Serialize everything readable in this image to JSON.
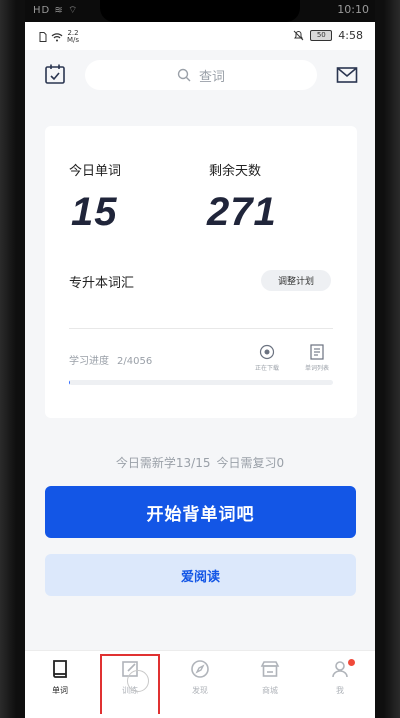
{
  "outer_status": {
    "left": "HD ≋ ⌔",
    "time": "10:10"
  },
  "status_bar": {
    "speed_top": "2.2",
    "speed_bottom": "M/s",
    "battery": "50",
    "time": "4:58"
  },
  "header": {
    "search_placeholder": "查词"
  },
  "stats": {
    "today_label": "今日单词",
    "today_value": "15",
    "remaining_label": "剩余天数",
    "remaining_value": "271",
    "book_name": "专升本词汇",
    "adjust_plan": "调整计划",
    "progress_label": "学习进度",
    "progress_value": "2/4056",
    "progress_fraction": 0.0005,
    "downloading_label": "正在下载",
    "word_list_label": "单词列表"
  },
  "summary": {
    "new": "今日需新学13/15",
    "review": "今日需复习0"
  },
  "buttons": {
    "start": "开始背单词吧",
    "read": "爱阅读"
  },
  "tabs": [
    "单词",
    "训练",
    "发现",
    "商城",
    "我"
  ],
  "colors": {
    "accent": "#1356e6",
    "light_accent": "#dce8fb",
    "badge": "#f04a3a"
  }
}
